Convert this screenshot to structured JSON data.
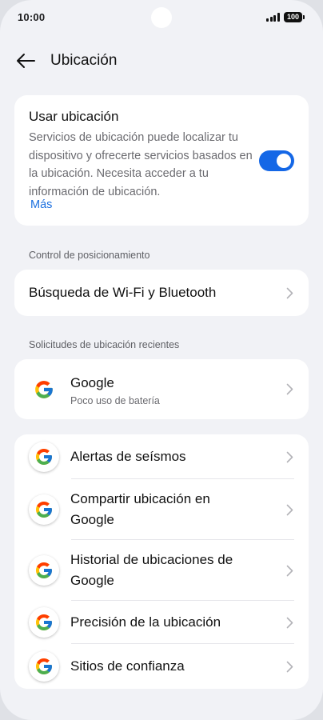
{
  "status_bar": {
    "time": "10:00",
    "battery": "100"
  },
  "header": {
    "title": "Ubicación",
    "back_icon": "arrow-left-icon"
  },
  "location_card": {
    "title": "Usar ubicación",
    "description": "Servicios de ubicación puede localizar tu dispositivo y ofrecerte servicios basados en la ubicación. Necesita acceder a tu información de ubicación.",
    "more_link": "Más",
    "toggle_on": true,
    "accent_color": "#1467e6"
  },
  "positioning": {
    "header": "Control de posicionamiento",
    "item": "Búsqueda de Wi-Fi y Bluetooth"
  },
  "recent": {
    "header": "Solicitudes de ubicación recientes",
    "items": [
      {
        "title": "Google",
        "subtitle": "Poco uso de batería",
        "icon": "google-icon"
      }
    ]
  },
  "services": {
    "items": [
      {
        "title": "Alertas de seísmos",
        "icon": "google-icon"
      },
      {
        "title": "Compartir ubicación en Google",
        "icon": "google-icon"
      },
      {
        "title": "Historial de ubicaciones de Google",
        "icon": "google-icon"
      },
      {
        "title": "Precisión de la ubicación",
        "icon": "google-icon"
      },
      {
        "title": "Sitios de confianza",
        "icon": "google-icon"
      }
    ]
  }
}
